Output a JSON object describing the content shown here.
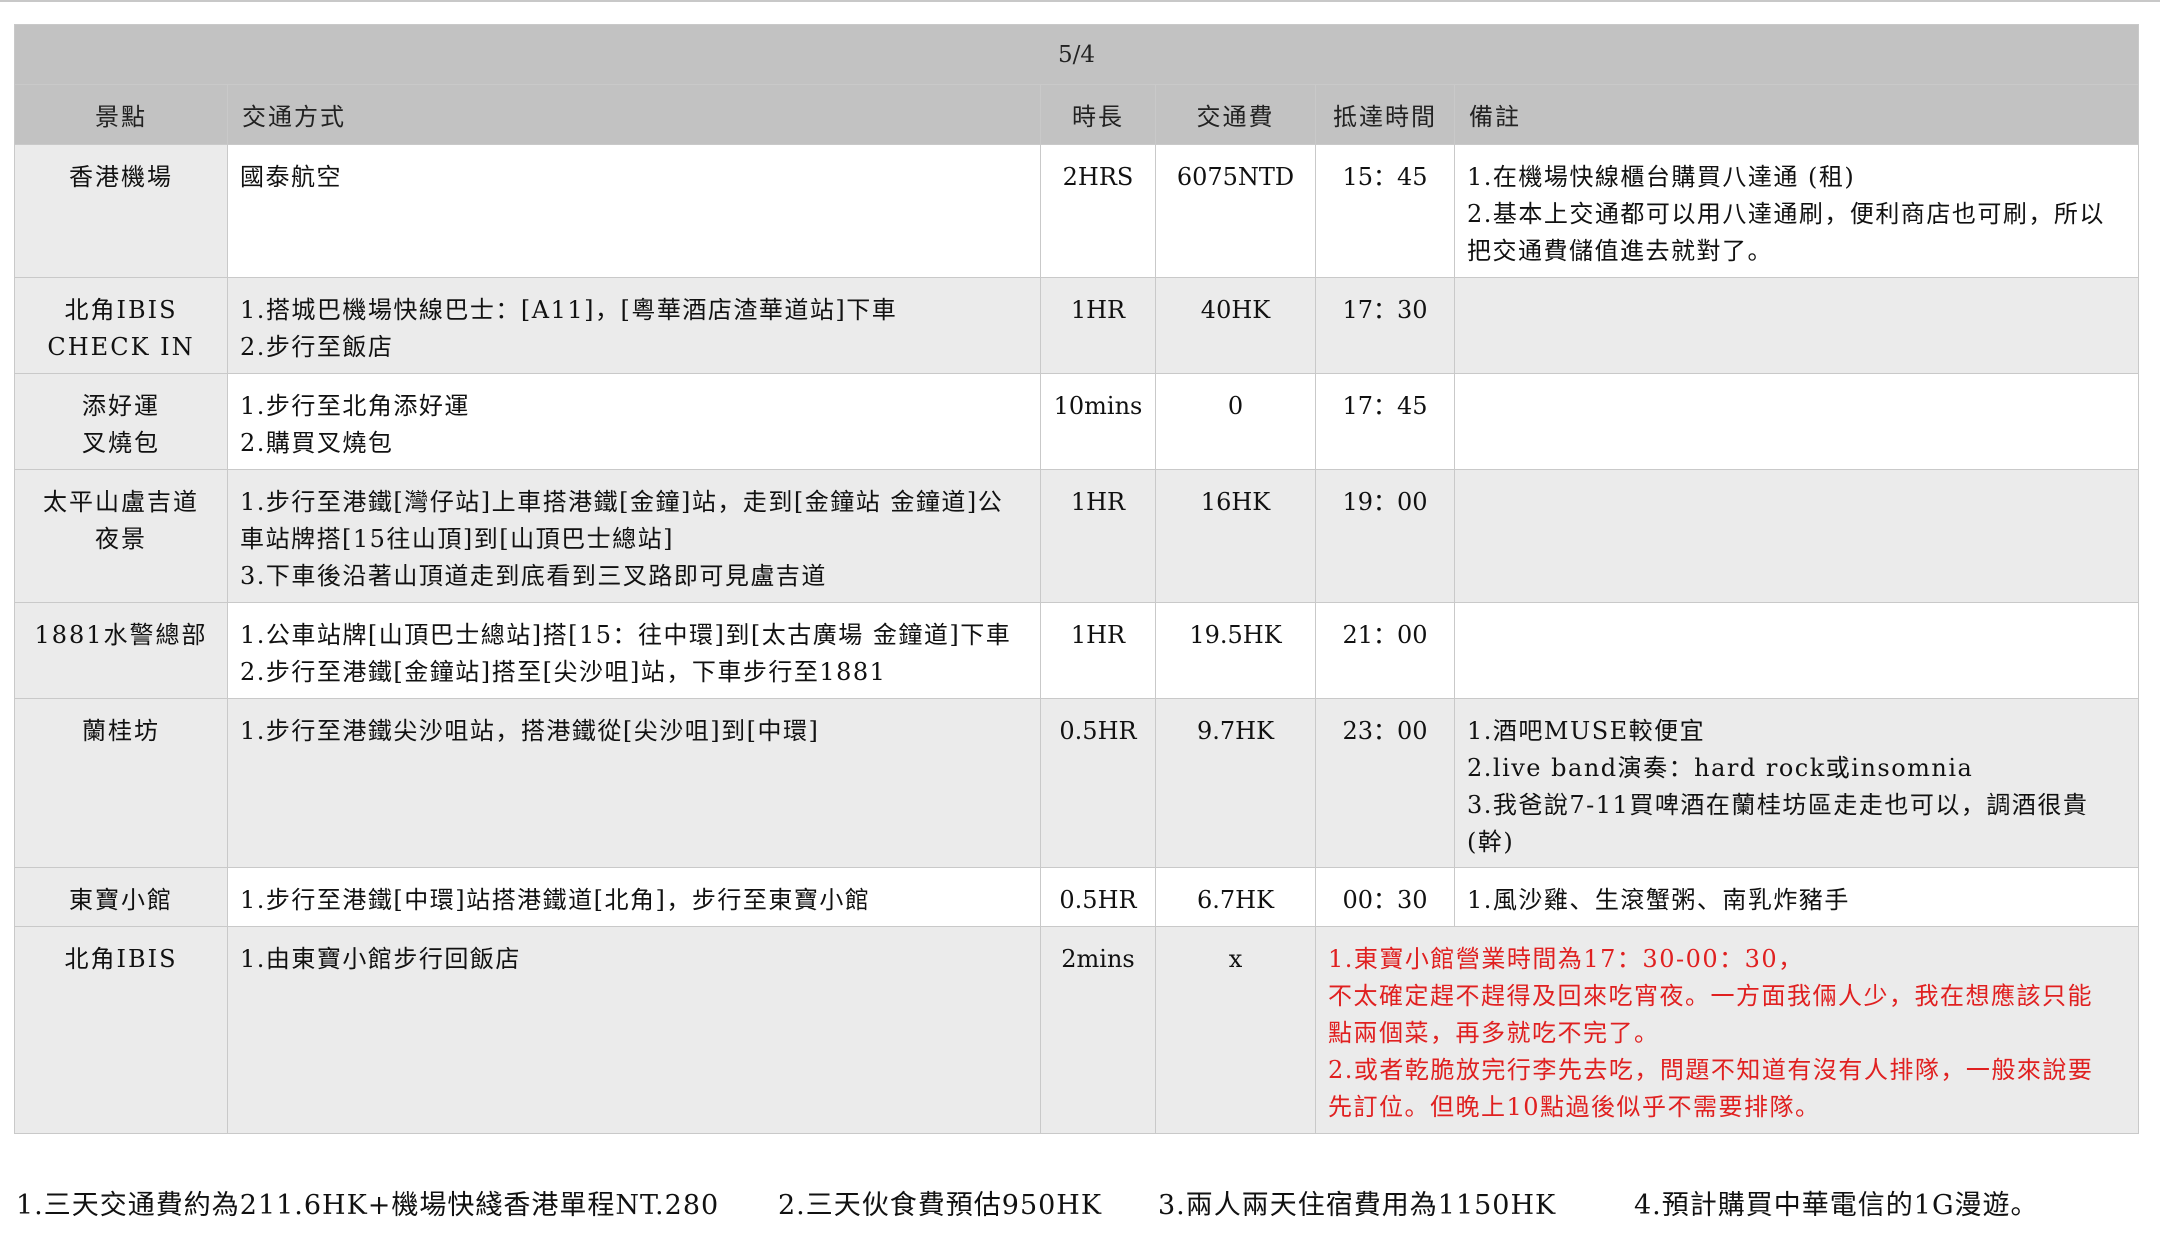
{
  "date": "5/4",
  "headers": {
    "spot": "景點",
    "transport": "交通方式",
    "duration": "時長",
    "fare": "交通費",
    "arrival": "抵達時間",
    "notes": "備註"
  },
  "rows": [
    {
      "spot": [
        "香港機場"
      ],
      "transport": [
        "國泰航空"
      ],
      "duration": "2HRS",
      "fare": "6075NTD",
      "arrival": "15：45",
      "notes": [
        "1.在機場快線櫃台購買八達通 (租)",
        "2.基本上交通都可以用八達通刷，便利商店也可刷，所以",
        "把交通費儲值進去就對了。"
      ],
      "notes_red": false
    },
    {
      "spot": [
        "北角IBIS",
        "CHECK IN"
      ],
      "transport": [
        "1.搭城巴機場快線巴士：[A11]，[粵華酒店渣華道站]下車",
        "2.步行至飯店"
      ],
      "duration": "1HR",
      "fare": "40HK",
      "arrival": "17：30",
      "notes": [],
      "notes_red": false
    },
    {
      "spot": [
        "添好運",
        "叉燒包"
      ],
      "transport": [
        "1.步行至北角添好運",
        "2.購買叉燒包"
      ],
      "duration": "10mins",
      "fare": "0",
      "arrival": "17：45",
      "notes": [],
      "notes_red": false
    },
    {
      "spot": [
        "太平山盧吉道",
        "夜景"
      ],
      "transport": [
        "1.步行至港鐵[灣仔站]上車搭港鐵[金鐘]站，走到[金鐘站 金鐘道]公",
        "車站牌搭[15往山頂]到[山頂巴士總站]",
        "3.下車後沿著山頂道走到底看到三叉路即可見盧吉道"
      ],
      "duration": "1HR",
      "fare": "16HK",
      "arrival": "19：00",
      "notes": [],
      "notes_red": false
    },
    {
      "spot": [
        "1881水警總部"
      ],
      "transport": [
        "1.公車站牌[山頂巴士總站]搭[15：往中環]到[太古廣場 金鐘道]下車",
        "2.步行至港鐵[金鐘站]搭至[尖沙咀]站，下車步行至1881"
      ],
      "duration": "1HR",
      "fare": "19.5HK",
      "arrival": "21：00",
      "notes": [],
      "notes_red": false
    },
    {
      "spot": [
        "蘭桂坊"
      ],
      "transport": [
        "1.步行至港鐵尖沙咀站，搭港鐵從[尖沙咀]到[中環]"
      ],
      "duration": "0.5HR",
      "fare": "9.7HK",
      "arrival": "23：00",
      "notes": [
        "1.酒吧MUSE較便宜",
        "2.live band演奏：hard rock或insomnia",
        "3.我爸說7-11買啤酒在蘭桂坊區走走也可以，調酒很貴",
        "(幹)"
      ],
      "notes_red": false
    },
    {
      "spot": [
        "東寶小館"
      ],
      "transport": [
        "1.步行至港鐵[中環]站搭港鐵道[北角]，步行至東寶小館"
      ],
      "duration": "0.5HR",
      "fare": "6.7HK",
      "arrival": "00：30",
      "notes": [
        "1.風沙雞、生滾蟹粥、南乳炸豬手"
      ],
      "notes_red": false
    },
    {
      "spot": [
        "北角IBIS"
      ],
      "transport": [
        "1.由東寶小館步行回飯店"
      ],
      "duration": "2mins",
      "fare": "x",
      "arrival": "",
      "notes": [
        "1.東寶小館營業時間為17：30-00：30，",
        "不太確定趕不趕得及回來吃宵夜。一方面我倆人少，我在想應該只能",
        "點兩個菜，再多就吃不完了。",
        "2.或者乾脆放完行李先去吃，問題不知道有沒有人排隊，一般來說要",
        "先訂位。但晚上10點過後似乎不需要排隊。"
      ],
      "notes_red": true
    }
  ],
  "footer": [
    "1.三天交通費約為211.6HK+機場快綫香港單程NT.280",
    "2.三天伙食費預估950HK",
    "3.兩人兩天住宿費用為1150HK",
    "4.預計購買中華電信的1G漫遊。"
  ]
}
